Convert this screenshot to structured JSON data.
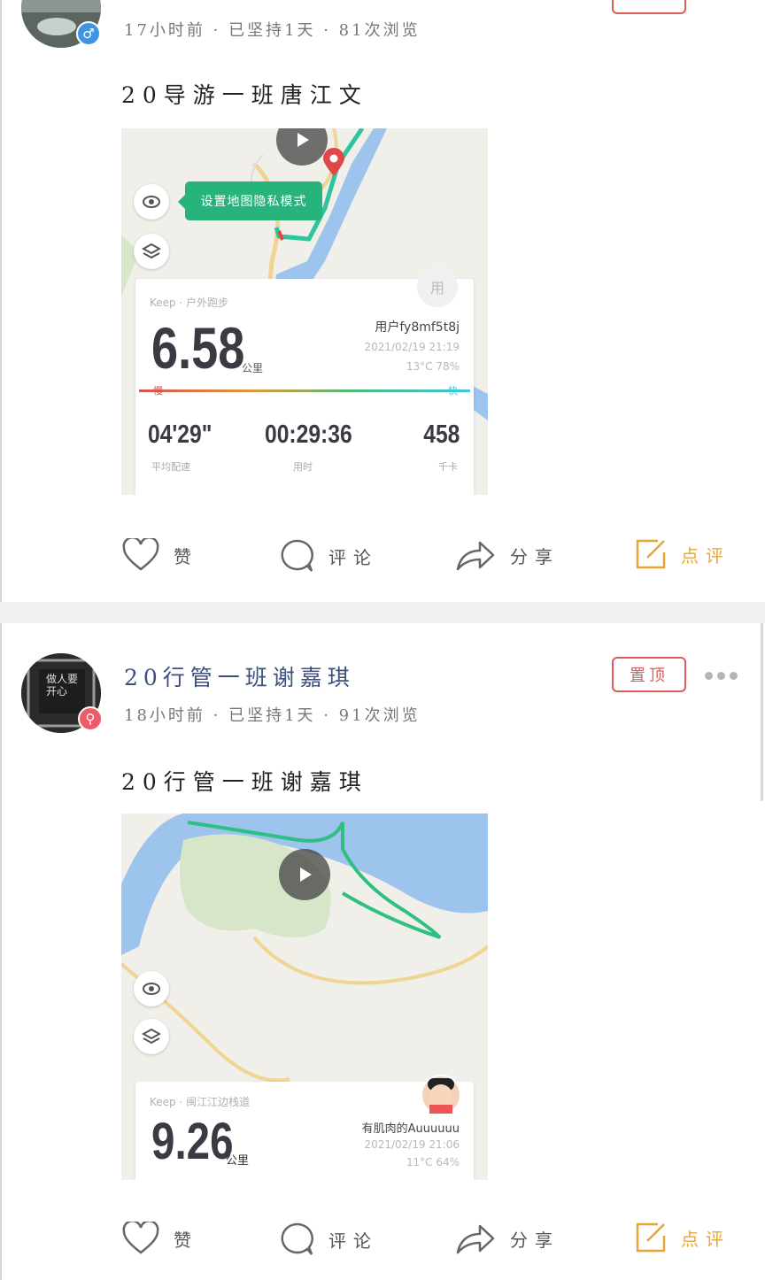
{
  "posts": [
    {
      "meta": "17小时前 · 已坚持1天 · 81次浏览",
      "title": "20导游一班唐江文",
      "map_tip": "设置地图隐私模式",
      "card": {
        "source": "Keep · 户外跑步",
        "distance": "6.58",
        "unit": "公里",
        "user": "用户fy8mf5t8j",
        "avatar_text": "用",
        "datetime": "2021/02/19 21:19",
        "weather": "13°C  78%",
        "pace_slow": "慢",
        "pace_fast": "快",
        "stats": [
          {
            "value": "04'29\"",
            "label": "平均配速"
          },
          {
            "value": "00:29:36",
            "label": "用时"
          },
          {
            "value": "458",
            "label": "千卡"
          }
        ]
      },
      "actions": {
        "like": "赞",
        "comment": "评论",
        "share": "分享",
        "review": "点评"
      }
    },
    {
      "author": "20行管一班谢嘉琪",
      "meta": "18小时前 · 已坚持1天 · 91次浏览",
      "pin_label": "置顶",
      "avatar_text": "做人要开心",
      "title": "20行管一班谢嘉琪",
      "card": {
        "source": "Keep · 闽江江边栈道",
        "distance": "9.26",
        "unit": "公里",
        "user": "有肌肉的Auuuuuu",
        "datetime": "2021/02/19 21:06",
        "weather": "11°C  64%"
      },
      "actions": {
        "like": "赞",
        "comment": "评论",
        "share": "分享",
        "review": "点评"
      }
    }
  ],
  "colors": {
    "accent_review": "#e8a533",
    "pin_red": "#e05a5a",
    "author_blue": "#3c4f7e",
    "route_green": "#27b47c",
    "river_blue": "#9cc4ec"
  }
}
